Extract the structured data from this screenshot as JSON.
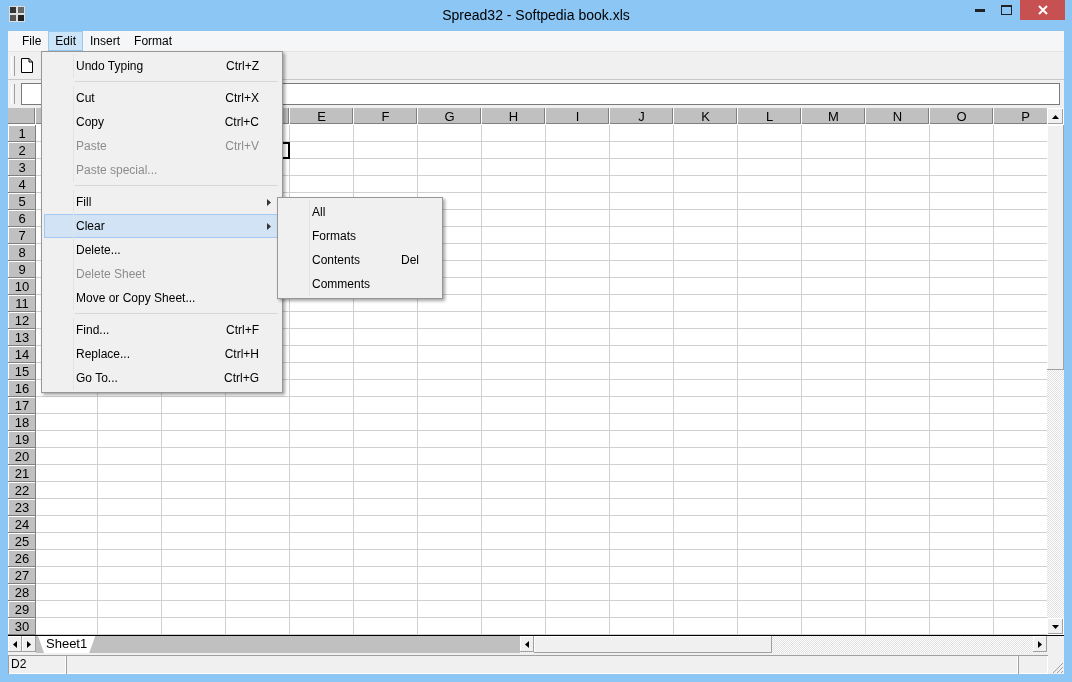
{
  "window": {
    "title": "Spread32 - Softpedia book.xls"
  },
  "menubar": [
    {
      "label": "File",
      "selected": false
    },
    {
      "label": "Edit",
      "selected": true
    },
    {
      "label": "Insert",
      "selected": false
    },
    {
      "label": "Format",
      "selected": false
    }
  ],
  "sheet": {
    "columns": [
      "E",
      "F",
      "G",
      "H",
      "I",
      "J",
      "K",
      "L",
      "M",
      "N",
      "O",
      "P"
    ],
    "rows": [
      {
        "number": "1"
      },
      {
        "number": "2",
        "cells": [
          null,
          null,
          null,
          {
            "selected": true
          }
        ]
      },
      {
        "number": "3"
      },
      {
        "number": "4"
      },
      {
        "number": "5"
      },
      {
        "number": "6"
      },
      {
        "number": "7"
      },
      {
        "number": "8"
      },
      {
        "number": "9"
      },
      {
        "number": "10"
      },
      {
        "number": "11"
      },
      {
        "number": "12"
      },
      {
        "number": "13"
      },
      {
        "number": "14"
      },
      {
        "number": "15"
      },
      {
        "number": "16"
      },
      {
        "number": "17"
      },
      {
        "number": "18"
      },
      {
        "number": "19"
      },
      {
        "number": "20"
      },
      {
        "number": "21"
      },
      {
        "number": "22"
      },
      {
        "number": "23"
      },
      {
        "number": "24"
      },
      {
        "number": "25"
      },
      {
        "number": "26"
      },
      {
        "number": "27"
      },
      {
        "number": "28"
      },
      {
        "number": "29"
      },
      {
        "number": "30"
      }
    ]
  },
  "sheet_tabs": [
    {
      "label": "Sheet1",
      "selected": true
    }
  ],
  "edit_menu": [
    {
      "kind": "item",
      "label": "Undo Typing",
      "shortcut": "Ctrl+Z",
      "disabled": false,
      "selected": false,
      "has_submenu": false
    },
    {
      "kind": "separator"
    },
    {
      "kind": "item",
      "label": "Cut",
      "shortcut": "Ctrl+X",
      "disabled": false,
      "selected": false,
      "has_submenu": false
    },
    {
      "kind": "item",
      "label": "Copy",
      "shortcut": "Ctrl+C",
      "disabled": false,
      "selected": false,
      "has_submenu": false
    },
    {
      "kind": "item",
      "label": "Paste",
      "shortcut": "Ctrl+V",
      "disabled": true,
      "selected": false,
      "has_submenu": false
    },
    {
      "kind": "item",
      "label": "Paste special...",
      "disabled": true,
      "selected": false,
      "has_submenu": false
    },
    {
      "kind": "separator"
    },
    {
      "kind": "item",
      "label": "Fill",
      "disabled": false,
      "selected": false,
      "has_submenu": true
    },
    {
      "kind": "item",
      "label": "Clear",
      "disabled": false,
      "selected": true,
      "has_submenu": true
    },
    {
      "kind": "item",
      "label": "Delete...",
      "disabled": false,
      "selected": false,
      "has_submenu": false
    },
    {
      "kind": "item",
      "label": "Delete Sheet",
      "disabled": true,
      "selected": false,
      "has_submenu": false
    },
    {
      "kind": "item",
      "label": "Move or Copy Sheet...",
      "disabled": false,
      "selected": false,
      "has_submenu": false
    },
    {
      "kind": "separator"
    },
    {
      "kind": "item",
      "label": "Find...",
      "shortcut": "Ctrl+F",
      "disabled": false,
      "selected": false,
      "has_submenu": false
    },
    {
      "kind": "item",
      "label": "Replace...",
      "shortcut": "Ctrl+H",
      "disabled": false,
      "selected": false,
      "has_submenu": false
    },
    {
      "kind": "item",
      "label": "Go To...",
      "shortcut": "Ctrl+G",
      "disabled": false,
      "selected": false,
      "has_submenu": false
    }
  ],
  "clear_submenu": [
    {
      "kind": "item",
      "label": "All",
      "disabled": false,
      "selected": false,
      "has_submenu": false
    },
    {
      "kind": "item",
      "label": "Formats",
      "disabled": false,
      "selected": false,
      "has_submenu": false
    },
    {
      "kind": "item",
      "label": "Contents",
      "shortcut": "Del",
      "disabled": false,
      "selected": false,
      "has_submenu": false
    },
    {
      "kind": "item",
      "label": "Comments",
      "disabled": false,
      "selected": false,
      "has_submenu": false
    }
  ],
  "status_bar": {
    "cell_reference": "D2"
  }
}
